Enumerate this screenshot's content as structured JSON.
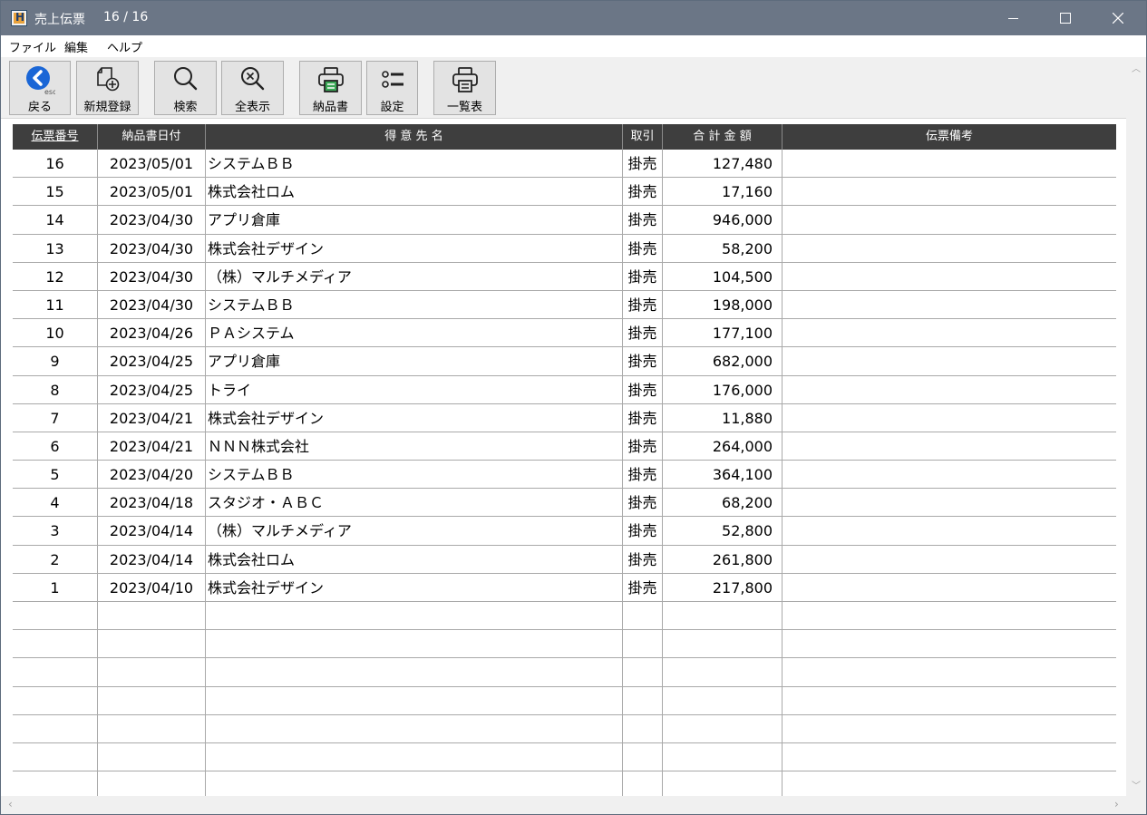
{
  "window": {
    "title": "売上伝票",
    "record_count": "16 / 16",
    "app_icon_letter": "H"
  },
  "menu": [
    "ファイル",
    "編集",
    "ヘルプ"
  ],
  "toolbar": {
    "back": "戻る",
    "new": "新規登録",
    "search": "検索",
    "show_all": "全表示",
    "delivery_note": "納品書",
    "settings": "設定",
    "list": "一覧表",
    "esc_hint": "esc"
  },
  "table": {
    "headers": {
      "no": "伝票番号",
      "date": "納品書日付",
      "customer": "得 意 先 名",
      "trade": "取引",
      "amount": "合 計 金 額",
      "note": "伝票備考"
    },
    "rows": [
      {
        "no": "16",
        "date": "2023/05/01",
        "customer": "システムＢＢ",
        "trade": "掛売",
        "amount": "127,480",
        "note": ""
      },
      {
        "no": "15",
        "date": "2023/05/01",
        "customer": "株式会社ロム",
        "trade": "掛売",
        "amount": "17,160",
        "note": ""
      },
      {
        "no": "14",
        "date": "2023/04/30",
        "customer": "アプリ倉庫",
        "trade": "掛売",
        "amount": "946,000",
        "note": ""
      },
      {
        "no": "13",
        "date": "2023/04/30",
        "customer": "株式会社デザイン",
        "trade": "掛売",
        "amount": "58,200",
        "note": ""
      },
      {
        "no": "12",
        "date": "2023/04/30",
        "customer": "（株）マルチメディア",
        "trade": "掛売",
        "amount": "104,500",
        "note": ""
      },
      {
        "no": "11",
        "date": "2023/04/30",
        "customer": "システムＢＢ",
        "trade": "掛売",
        "amount": "198,000",
        "note": ""
      },
      {
        "no": "10",
        "date": "2023/04/26",
        "customer": "ＰＡシステム",
        "trade": "掛売",
        "amount": "177,100",
        "note": ""
      },
      {
        "no": "9",
        "date": "2023/04/25",
        "customer": "アプリ倉庫",
        "trade": "掛売",
        "amount": "682,000",
        "note": ""
      },
      {
        "no": "8",
        "date": "2023/04/25",
        "customer": "トライ",
        "trade": "掛売",
        "amount": "176,000",
        "note": ""
      },
      {
        "no": "7",
        "date": "2023/04/21",
        "customer": "株式会社デザイン",
        "trade": "掛売",
        "amount": "11,880",
        "note": ""
      },
      {
        "no": "6",
        "date": "2023/04/21",
        "customer": "ＮＮＮ株式会社",
        "trade": "掛売",
        "amount": "264,000",
        "note": ""
      },
      {
        "no": "5",
        "date": "2023/04/20",
        "customer": "システムＢＢ",
        "trade": "掛売",
        "amount": "364,100",
        "note": ""
      },
      {
        "no": "4",
        "date": "2023/04/18",
        "customer": "スタジオ・ＡＢＣ",
        "trade": "掛売",
        "amount": "68,200",
        "note": ""
      },
      {
        "no": "3",
        "date": "2023/04/14",
        "customer": "（株）マルチメディア",
        "trade": "掛売",
        "amount": "52,800",
        "note": ""
      },
      {
        "no": "2",
        "date": "2023/04/14",
        "customer": "株式会社ロム",
        "trade": "掛売",
        "amount": "261,800",
        "note": ""
      },
      {
        "no": "1",
        "date": "2023/04/10",
        "customer": "株式会社デザイン",
        "trade": "掛売",
        "amount": "217,800",
        "note": ""
      }
    ],
    "empty_rows": 7
  },
  "colors": {
    "titlebar": "#6b7686",
    "header_bg": "#3e3e3e",
    "back_button_blue": "#1a66d6",
    "printer_green": "#3aa655"
  },
  "icons": {
    "back": "back-circle-arrow-icon",
    "new": "new-document-plus-icon",
    "search": "magnifier-icon",
    "show_all": "magnifier-x-icon",
    "delivery_note": "printer-green-icon",
    "settings": "settings-list-icon",
    "list": "printer-icon"
  }
}
